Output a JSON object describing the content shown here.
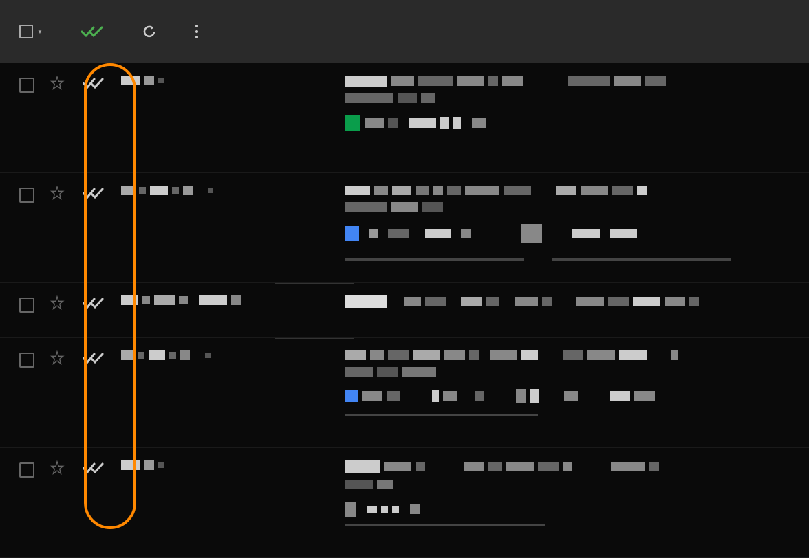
{
  "toolbar": {
    "select_all": "select-all",
    "double_check": "double-check",
    "refresh": "refresh",
    "more": "more-options"
  },
  "colors": {
    "highlight": "#ff8800",
    "check_green": "#4caf50",
    "accent_green": "#0a9d4b",
    "accent_blue": "#4285f4"
  },
  "rows": [
    {
      "id": 0,
      "type": "tall",
      "has_attachment": false,
      "has_green_block": true
    },
    {
      "id": 1,
      "type": "tall",
      "has_attachment": true,
      "has_blue_block": true
    },
    {
      "id": 2,
      "type": "short",
      "has_attachment": false
    },
    {
      "id": 3,
      "type": "tall",
      "has_attachment": true,
      "has_blue_small": true
    },
    {
      "id": 4,
      "type": "tall",
      "has_attachment": true
    }
  ]
}
